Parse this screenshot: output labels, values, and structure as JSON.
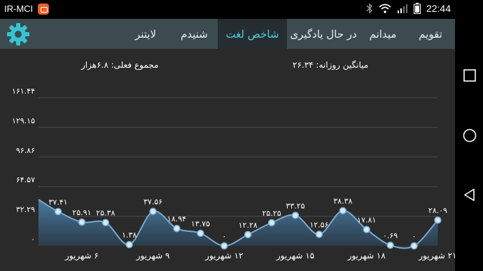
{
  "status_bar": {
    "carrier": "IR-MCI",
    "time": "22:44"
  },
  "app_bar": {
    "tabs": [
      {
        "label": "تقویم",
        "width": 70,
        "active": false
      },
      {
        "label": "میدانم",
        "width": 66,
        "active": false
      },
      {
        "label": "در حال یادگیری",
        "width": 104,
        "active": false
      },
      {
        "label": "شاخص لغت",
        "width": 99,
        "active": true
      },
      {
        "label": "شنیدم",
        "width": 67,
        "active": false
      },
      {
        "label": "لایتنر",
        "width": 72,
        "active": false
      }
    ]
  },
  "stats": {
    "daily_average": "میانگین روزانه: ۲۶.۳۴",
    "current_total": "مجموع فعلی: ۶.۸هزار"
  },
  "chart_data": {
    "type": "area",
    "y_ticks": [
      "۱۶۱.۴۴",
      "۱۲۹.۱۵",
      "۹۶.۸۶",
      "۶۴.۵۷",
      "۳۲.۲۹",
      "۰"
    ],
    "ylim": [
      0,
      161.44
    ],
    "x_labels": [
      "۶ شهریور",
      "۹ شهریور",
      "۱۲ شهریور",
      "۱۵ شهریور",
      "۱۸ شهریور",
      "۲۱ شهریور"
    ],
    "series": [
      {
        "values": [
          37.41,
          25.91,
          25.38,
          1.38,
          37.56,
          18.94,
          13.75,
          0,
          12.28,
          25.25,
          33.25,
          12.56,
          38.38,
          17.81,
          0.69,
          0,
          28.09
        ],
        "labels": [
          "۳۷.۴۱",
          "۲۵.۹۱",
          "۲۵.۳۸",
          "۱.۳۸",
          "۳۷.۵۶",
          "۱۸.۹۴",
          "۱۳.۷۵",
          "۰",
          "۱۲.۲۸",
          "۲۵.۲۵",
          "۳۳.۲۵",
          "۱۲.۵۶",
          "۳۸.۳۸",
          "۱۷.۸۱",
          "۰.۶۹",
          "۰",
          "۲۸.۰۹"
        ]
      }
    ],
    "leading_value": 50.5,
    "grid": true,
    "colors": {
      "line": "#7aa9cf",
      "marker": "#cfeaf8",
      "fill": "#4a7ea8"
    }
  }
}
